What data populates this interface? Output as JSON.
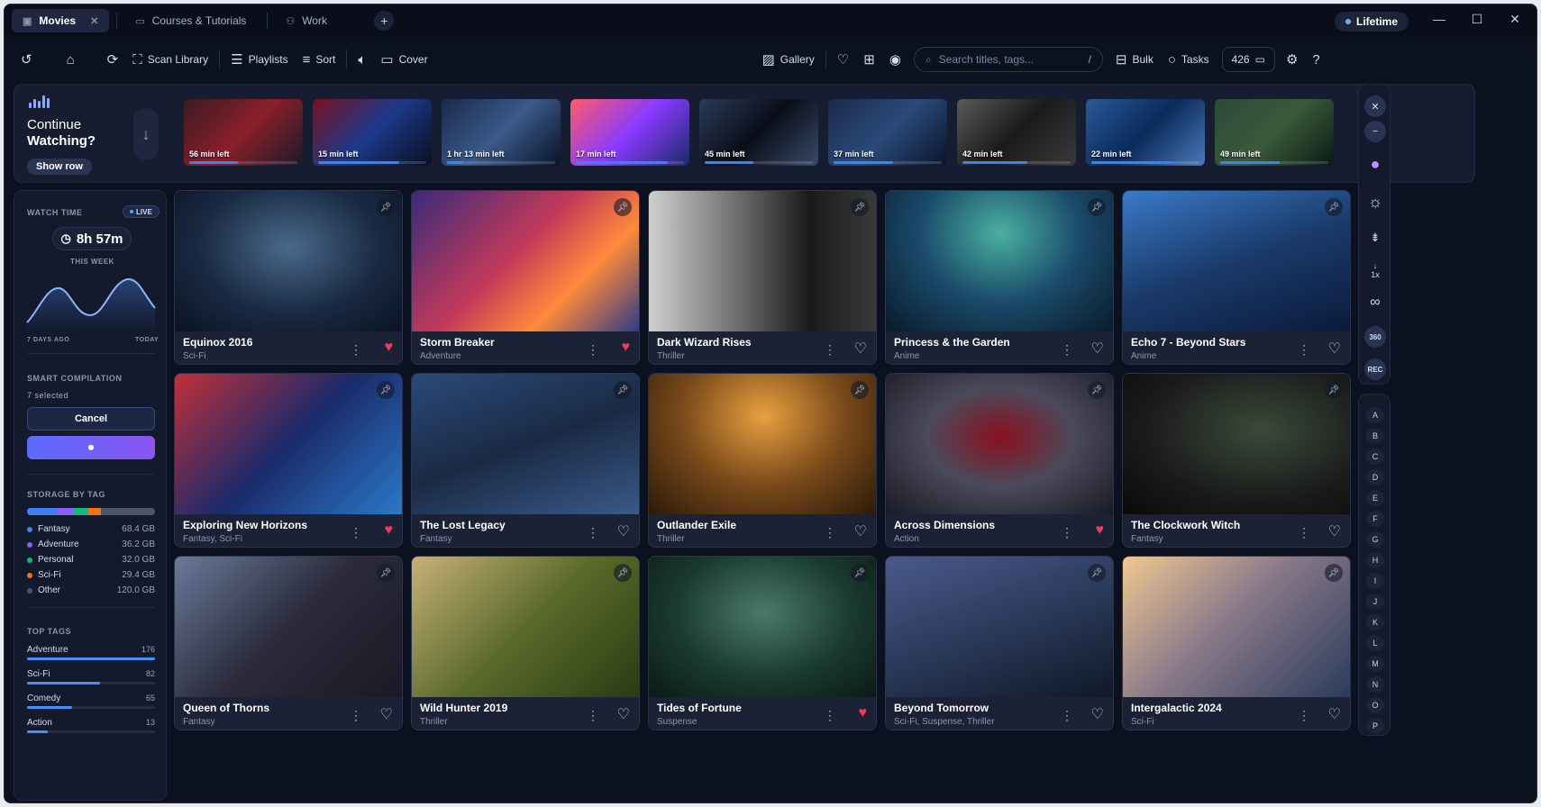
{
  "tabs": [
    {
      "label": "Movies",
      "icon": "film-icon",
      "active": true
    },
    {
      "label": "Courses & Tutorials",
      "icon": "monitor-icon"
    },
    {
      "label": "Work",
      "icon": "user-icon"
    }
  ],
  "badge": {
    "label": "Lifetime"
  },
  "toolbar": {
    "scan": "Scan Library",
    "playlists": "Playlists",
    "sort": "Sort",
    "cover": "Cover",
    "gallery": "Gallery",
    "search_placeholder": "Search titles, tags...",
    "search_shortcut": "/",
    "bulk": "Bulk",
    "tasks": "Tasks",
    "count": "426"
  },
  "continue": {
    "line1": "Continue",
    "line2": "Watching?",
    "show_row": "Show row",
    "items": [
      {
        "left": "56 min left",
        "progress": 0.45
      },
      {
        "left": "15 min left",
        "progress": 0.75
      },
      {
        "left": "1 hr 13 min left",
        "progress": 0.15
      },
      {
        "left": "17 min left",
        "progress": 0.85
      },
      {
        "left": "45 min left",
        "progress": 0.45
      },
      {
        "left": "37 min left",
        "progress": 0.55
      },
      {
        "left": "42 min left",
        "progress": 0.6
      },
      {
        "left": "22 min left",
        "progress": 0.75
      },
      {
        "left": "49 min left",
        "progress": 0.55
      }
    ]
  },
  "watch": {
    "label": "WATCH TIME",
    "live": "LIVE",
    "time": "8h 57m",
    "period": "THIS WEEK",
    "start": "7 DAYS AGO",
    "end": "TODAY"
  },
  "smart": {
    "label": "SMART COMPILATION",
    "selected": "7 selected",
    "cancel": "Cancel"
  },
  "storage": {
    "label": "STORAGE BY TAG",
    "items": [
      {
        "name": "Fantasy",
        "size": "68.4 GB",
        "color": "#3b82f6"
      },
      {
        "name": "Adventure",
        "size": "36.2 GB",
        "color": "#8b5cf6"
      },
      {
        "name": "Personal",
        "size": "32.0 GB",
        "color": "#10b981"
      },
      {
        "name": "Sci-Fi",
        "size": "29.4 GB",
        "color": "#f97316"
      },
      {
        "name": "Other",
        "size": "120.0 GB",
        "color": "#4b5568"
      }
    ]
  },
  "top_tags": {
    "label": "TOP TAGS",
    "items": [
      {
        "name": "Adventure",
        "count": "176",
        "fill": 1.0
      },
      {
        "name": "Sci-Fi",
        "count": "82",
        "fill": 0.57
      },
      {
        "name": "Comedy",
        "count": "65",
        "fill": 0.35
      },
      {
        "name": "Action",
        "count": "13",
        "fill": 0.16
      }
    ]
  },
  "cards": [
    {
      "title": "Equinox 2016",
      "genre": "Sci-Fi",
      "fav": true
    },
    {
      "title": "Storm Breaker",
      "genre": "Adventure",
      "fav": true
    },
    {
      "title": "Dark Wizard Rises",
      "genre": "Thriller",
      "fav": false
    },
    {
      "title": "Princess & the Garden",
      "genre": "Anime",
      "fav": false
    },
    {
      "title": "Echo 7 - Beyond Stars",
      "genre": "Anime",
      "fav": false
    },
    {
      "title": "Exploring New Horizons",
      "genre": "Fantasy, Sci-Fi",
      "fav": true
    },
    {
      "title": "The Lost Legacy",
      "genre": "Fantasy",
      "fav": false
    },
    {
      "title": "Outlander Exile",
      "genre": "Thriller",
      "fav": false
    },
    {
      "title": "Across Dimensions",
      "genre": "Action",
      "fav": true
    },
    {
      "title": "The Clockwork Witch",
      "genre": "Fantasy",
      "fav": false
    },
    {
      "title": "Queen of Thorns",
      "genre": "Fantasy",
      "fav": false
    },
    {
      "title": "Wild Hunter 2019",
      "genre": "Thriller",
      "fav": false
    },
    {
      "title": "Tides of Fortune",
      "genre": "Suspense",
      "fav": true
    },
    {
      "title": "Beyond Tomorrow",
      "genre": "Sci-Fi, Suspense, Thriller",
      "fav": false
    },
    {
      "title": "Intergalactic 2024",
      "genre": "Sci-Fi",
      "fav": false
    }
  ],
  "rail": {
    "speed": "1x",
    "vr": "360",
    "rec": "REC"
  },
  "letters": [
    "A",
    "B",
    "C",
    "D",
    "E",
    "F",
    "G",
    "H",
    "I",
    "J",
    "K",
    "L",
    "M",
    "N",
    "O",
    "P"
  ]
}
